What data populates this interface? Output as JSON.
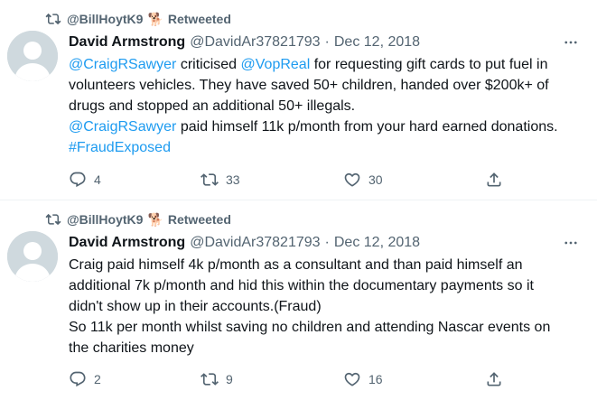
{
  "colors": {
    "text": "#0f1419",
    "secondary": "#536471",
    "link": "#1d9bf0",
    "divider": "#eff3f4",
    "avatar_bg": "#cfd9de"
  },
  "tweets": [
    {
      "retweeted_by": "@BillHoytK9",
      "retweeted_emoji": "🐕",
      "retweeted_label": "Retweeted",
      "author_name": "David Armstrong",
      "author_handle": "@DavidAr37821793",
      "separator": "·",
      "date": "Dec 12, 2018",
      "text_parts": [
        {
          "t": "@CraigRSawyer",
          "link": true
        },
        {
          "t": " criticised ",
          "link": false
        },
        {
          "t": "@VopReal",
          "link": true
        },
        {
          "t": " for requesting gift cards to put fuel in\nvolunteers vehicles. They have saved 50+ children, handed over $200k+ of\ndrugs and stopped an additional 50+ illegals.\n",
          "link": false
        },
        {
          "t": "@CraigRSawyer",
          "link": true
        },
        {
          "t": " paid himself 11k p/month from your hard earned donations.\n",
          "link": false
        },
        {
          "t": "#FraudExposed",
          "link": true
        }
      ],
      "replies": "4",
      "retweets": "33",
      "likes": "30"
    },
    {
      "retweeted_by": "@BillHoytK9",
      "retweeted_emoji": "🐕",
      "retweeted_label": "Retweeted",
      "author_name": "David Armstrong",
      "author_handle": "@DavidAr37821793",
      "separator": "·",
      "date": "Dec 12, 2018",
      "text_parts": [
        {
          "t": "Craig paid himself 4k p/month as a consultant and than paid himself an\nadditional 7k p/month and hid this within the documentary payments so it\ndidn't show up in their accounts.(Fraud)\nSo 11k per month whilst saving no children and attending Nascar events on\nthe charities money",
          "link": false
        }
      ],
      "replies": "2",
      "retweets": "9",
      "likes": "16"
    }
  ]
}
